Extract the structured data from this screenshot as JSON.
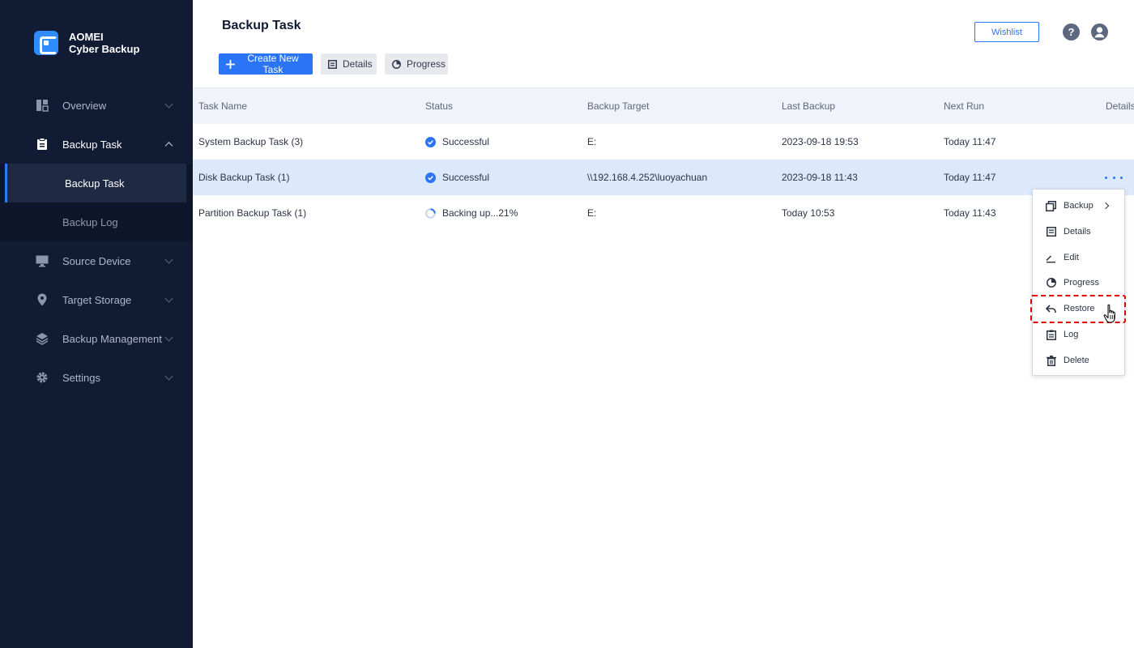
{
  "brand": {
    "line1": "AOMEI",
    "line2": "Cyber Backup"
  },
  "sidebar": {
    "items": [
      {
        "label": "Overview",
        "icon": "overview-icon"
      },
      {
        "label": "Backup Task",
        "icon": "clipboard-icon",
        "expanded": true,
        "children": [
          {
            "label": "Backup Task",
            "selected": true
          },
          {
            "label": "Backup Log"
          }
        ]
      },
      {
        "label": "Source Device",
        "icon": "monitor-icon"
      },
      {
        "label": "Target Storage",
        "icon": "location-pin-icon"
      },
      {
        "label": "Backup Management",
        "icon": "layers-icon"
      },
      {
        "label": "Settings",
        "icon": "gear-icon"
      }
    ]
  },
  "header": {
    "title": "Backup Task",
    "create_label": "Create New Task",
    "details_label": "Details",
    "progress_label": "Progress",
    "wishlist_label": "Wishlist",
    "help_glyph": "?"
  },
  "table": {
    "columns": [
      "Task Name",
      "Status",
      "Backup Target",
      "Last Backup",
      "Next Run",
      "Details"
    ],
    "rows": [
      {
        "name": "System Backup Task (3)",
        "status": "Successful",
        "target": "E:",
        "last": "2023-09-18 19:53",
        "next": "Today 11:47"
      },
      {
        "name": "Disk Backup Task (1)",
        "status": "Successful",
        "target": "\\\\192.168.4.252\\luoyachuan",
        "last": "2023-09-18 11:43",
        "next": "Today 11:47",
        "highlighted": true
      },
      {
        "name": "Partition Backup Task (1)",
        "status": "Backing up...21%",
        "target": "E:",
        "last": "Today 10:53",
        "next": "Today 11:43"
      }
    ]
  },
  "context_menu": {
    "items": [
      {
        "label": "Backup",
        "icon": "copy-icon",
        "has_submenu": true
      },
      {
        "label": "Details",
        "icon": "details-icon"
      },
      {
        "label": "Edit",
        "icon": "edit-icon"
      },
      {
        "label": "Progress",
        "icon": "pie-icon"
      },
      {
        "label": "Restore",
        "icon": "restore-arrow-icon",
        "highlighted": true
      },
      {
        "label": "Log",
        "icon": "log-icon"
      },
      {
        "label": "Delete",
        "icon": "trash-icon"
      }
    ]
  },
  "colors": {
    "sidebar_bg": "#111b33",
    "accent": "#2a74f5",
    "highlight_row": "#dce8fb",
    "annotation": "#e00000"
  }
}
